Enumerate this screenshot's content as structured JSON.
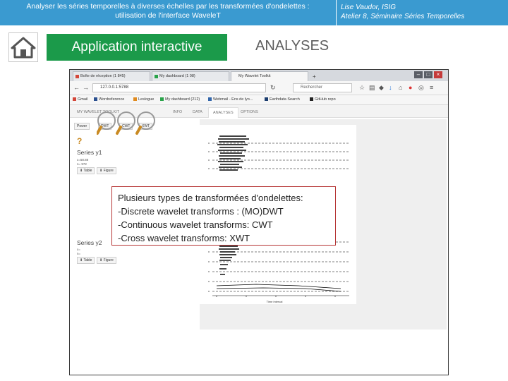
{
  "slide": {
    "title_line1": "Analyser les séries temporelles à diverses échelles par les transformées d'ondelettes :",
    "title_line2": "utilisation de l'interface WaveleT",
    "author_line1": "Lise Vaudor, ISIG",
    "author_line2": "Atelier 8, Séminaire Séries Temporelles",
    "app_button": "Application interactive",
    "section_label": "ANALYSES",
    "header_color": "#3a9ad0",
    "button_color": "#1b9a4a",
    "callout_border_color": "#b53434"
  },
  "browser": {
    "tabs": [
      "Boîte de réception (1 845)",
      "My dashboard (1 08)",
      "My Wavelet Toolkit"
    ],
    "url": "127.0.0.1:5788",
    "search_placeholder": "Rechercher",
    "bookmarks": [
      "Gmail",
      "Wordreference",
      "Leslogue",
      "My dashboard (212)",
      "Webmail - Ens de lyo...",
      "Earthdata Search",
      "GitHub repo"
    ]
  },
  "app": {
    "tabs": [
      "MY WAVELET TOOLKIT",
      "INFO",
      "DATA",
      "ANALYSES",
      "OPTIONS"
    ],
    "active_tab": 3,
    "power_label": "Power",
    "method_labels": [
      "DWT",
      "CWT",
      "XWT"
    ],
    "help_mark": "?",
    "series1": {
      "name": "Series y1",
      "stat1": "x=58.88",
      "stat2": "n= 972",
      "table_label": "Table",
      "figure_label": "Figure"
    },
    "series2": {
      "name": "Series y2",
      "stat1": "x=",
      "stat2": "n=",
      "table_label": "Table",
      "figure_label": "Figure"
    },
    "plot_xlabel": "Time interval"
  },
  "callout": {
    "lines": [
      "Plusieurs types de transformées d'ondelettes:",
      "-Discrete wavelet transforms : (MO)DWT",
      "-Continuous wavelet transforms: CWT",
      "-Cross wavelet transforms: XWT"
    ]
  }
}
